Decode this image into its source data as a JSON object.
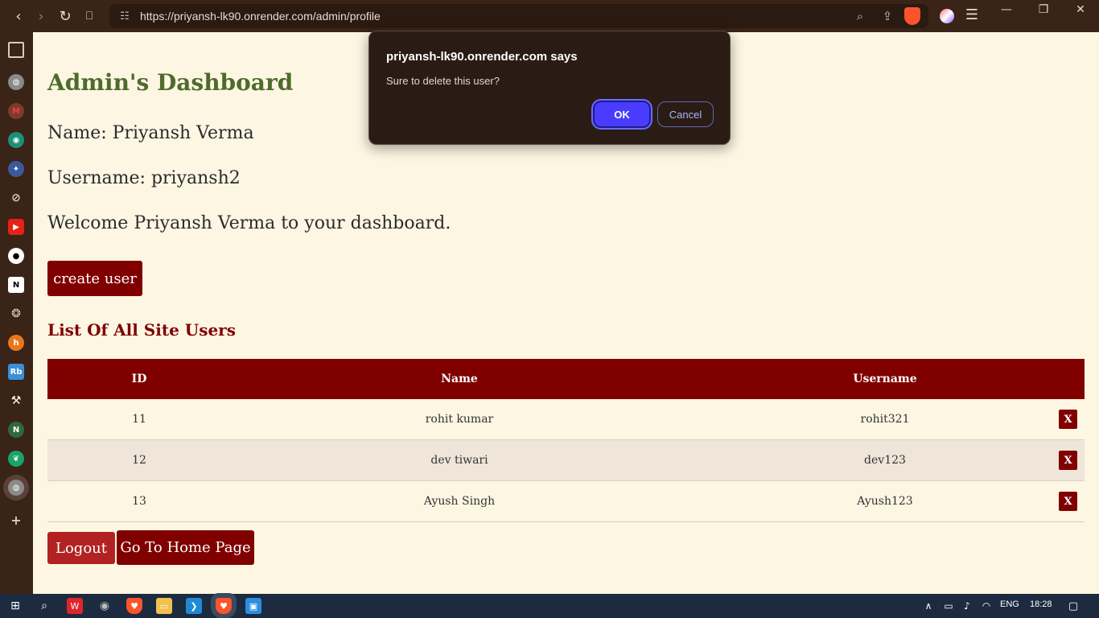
{
  "browser": {
    "url": "https://priyansh-lk90.onrender.com/admin/profile",
    "nav": {
      "back": "‹",
      "forward": "›",
      "reload": "↻",
      "bookmark": "⎕"
    },
    "window": {
      "minimize": "—",
      "restore": "❐",
      "close": "✕"
    }
  },
  "sidebar": {
    "icons": [
      "sidebar-panel-icon",
      "globe-icon",
      "gmail-icon",
      "app-icon",
      "gemini-icon",
      "no-sign-icon",
      "youtube-icon",
      "github-icon",
      "notion-icon",
      "chatgpt-icon",
      "hashnode-icon",
      "rb-icon",
      "tool-icon",
      "codechef-icon",
      "leaf-icon",
      "globe-icon",
      "add-icon"
    ]
  },
  "page": {
    "title": "Admin's Dashboard",
    "name_line": "Name: Priyansh Verma",
    "username_line": "Username: priyansh2",
    "welcome_line": "Welcome Priyansh Verma to your dashboard.",
    "create_user_label": "create user",
    "list_title": "List Of All Site Users",
    "table": {
      "headers": {
        "id": "ID",
        "name": "Name",
        "username": "Username"
      },
      "rows": [
        {
          "id": "11",
          "name": "rohit kumar",
          "username": "rohit321",
          "delete": "X"
        },
        {
          "id": "12",
          "name": "dev tiwari",
          "username": "dev123",
          "delete": "X"
        },
        {
          "id": "13",
          "name": "Ayush Singh",
          "username": "Ayush123",
          "delete": "X"
        }
      ]
    },
    "logout_label": "Logout",
    "home_label": "Go To Home Page"
  },
  "dialog": {
    "title": "priyansh-lk90.onrender.com says",
    "message": "Sure to delete this user?",
    "ok_label": "OK",
    "cancel_label": "Cancel"
  },
  "taskbar": {
    "language": "ENG",
    "time": "18:28"
  },
  "colors": {
    "page_bg": "#fdf6e3",
    "maroon": "#800000",
    "title_green": "#4e6b2c",
    "dialog_ok": "#4a3cff"
  }
}
